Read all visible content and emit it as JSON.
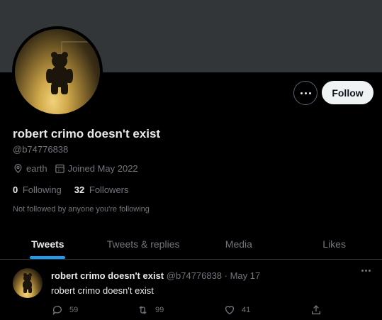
{
  "profile": {
    "name": "robert crimo doesn't exist",
    "handle": "@b74776838",
    "location": "earth",
    "joined": "Joined May 2022",
    "following_count": "0",
    "following_label": "Following",
    "followers_count": "32",
    "followers_label": "Followers",
    "followed_by": "Not followed by anyone you're following"
  },
  "actions": {
    "follow_label": "Follow"
  },
  "tabs": [
    {
      "label": "Tweets",
      "active": true
    },
    {
      "label": "Tweets & replies",
      "active": false
    },
    {
      "label": "Media",
      "active": false
    },
    {
      "label": "Likes",
      "active": false
    }
  ],
  "tweet": {
    "name": "robert crimo doesn't exist",
    "meta": "@b74776838 · May 17",
    "text": "robert crimo doesn't exist",
    "replies": "59",
    "retweets": "99",
    "likes": "41"
  },
  "colors": {
    "accent": "#1d9bf0",
    "banner": "#333639",
    "muted": "#71767b"
  },
  "icons": [
    "more-icon",
    "location-icon",
    "calendar-icon",
    "reply-icon",
    "retweet-icon",
    "like-icon",
    "share-icon"
  ]
}
